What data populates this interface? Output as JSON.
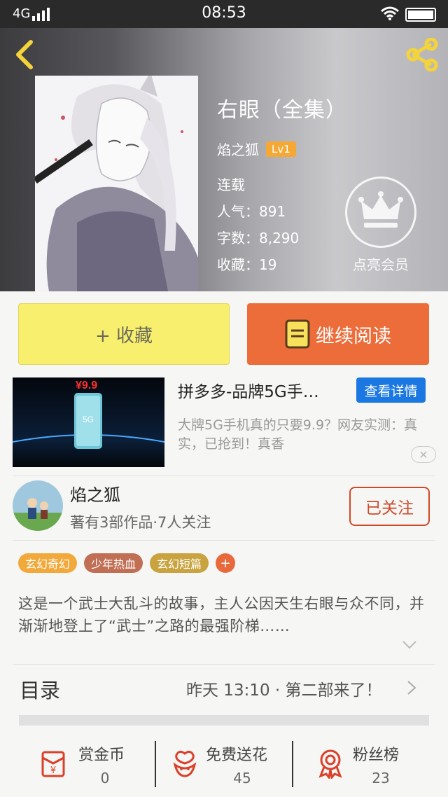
{
  "status_bar": {
    "network": "4G",
    "time": "08:53"
  },
  "book": {
    "title": "右眼（全集）",
    "author": "焰之狐",
    "author_level": "Lv1",
    "status": "连载",
    "popularity": "人气：891",
    "word_count": "字数：8,290",
    "favorites": "收藏：19",
    "vip_label": "点亮会员"
  },
  "actions": {
    "favorite_label": "+ 收藏",
    "read_label": "继续阅读"
  },
  "ad": {
    "title": "拼多多-品牌5G手…",
    "detail_button": "查看详情",
    "description": "大牌5G手机真的只要9.9？网友实测：真实，已抢到！真香",
    "close_label": "✕",
    "image_price": "¥9.9",
    "image_badge": "5G"
  },
  "author_card": {
    "name": "焰之狐",
    "subtitle": "著有3部作品·7人关注",
    "follow_label": "已关注"
  },
  "tags": [
    {
      "label": "玄幻奇幻",
      "color": "#f2a93b"
    },
    {
      "label": "少年热血",
      "color": "#c06f55"
    },
    {
      "label": "玄幻短篇",
      "color": "#c9a33f"
    },
    {
      "label": "+",
      "color": "#e86a3c"
    }
  ],
  "description": "这是一个武士大乱斗的故事，主人公因天生右眼与众不同，并渐渐地登上了“武士”之路的最强阶梯……",
  "toc": {
    "label": "目录",
    "latest": "昨天 13:10 · 第二部来了！"
  },
  "stats": [
    {
      "label": "赏金币",
      "value": "0",
      "icon": "reward-envelope-icon"
    },
    {
      "label": "免费送花",
      "value": "45",
      "icon": "flower-icon"
    },
    {
      "label": "粉丝榜",
      "value": "23",
      "icon": "medal-icon"
    }
  ],
  "colors": {
    "accent_orange": "#ec6c3a",
    "favorite_yellow": "#f8ef6f",
    "ad_blue": "#1b78e2",
    "follow_red": "#d04a2a"
  }
}
